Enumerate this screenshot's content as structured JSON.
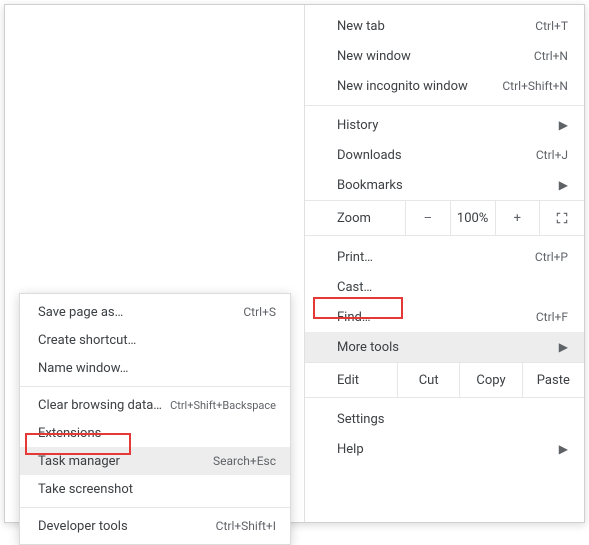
{
  "main_menu": {
    "new_tab": {
      "label": "New tab",
      "shortcut": "Ctrl+T"
    },
    "new_window": {
      "label": "New window",
      "shortcut": "Ctrl+N"
    },
    "new_incognito": {
      "label": "New incognito window",
      "shortcut": "Ctrl+Shift+N"
    },
    "history": {
      "label": "History"
    },
    "downloads": {
      "label": "Downloads",
      "shortcut": "Ctrl+J"
    },
    "bookmarks": {
      "label": "Bookmarks"
    },
    "zoom": {
      "label": "Zoom",
      "minus": "–",
      "value": "100%",
      "plus": "+"
    },
    "print": {
      "label": "Print…",
      "shortcut": "Ctrl+P"
    },
    "cast": {
      "label": "Cast…"
    },
    "find": {
      "label": "Find…",
      "shortcut": "Ctrl+F"
    },
    "more_tools": {
      "label": "More tools"
    },
    "edit": {
      "label": "Edit",
      "cut": "Cut",
      "copy": "Copy",
      "paste": "Paste"
    },
    "settings": {
      "label": "Settings"
    },
    "help": {
      "label": "Help"
    }
  },
  "submenu": {
    "save_page": {
      "label": "Save page as…",
      "shortcut": "Ctrl+S"
    },
    "create_shortcut": {
      "label": "Create shortcut…"
    },
    "name_window": {
      "label": "Name window…"
    },
    "clear_browsing": {
      "label": "Clear browsing data…",
      "shortcut": "Ctrl+Shift+Backspace"
    },
    "extensions": {
      "label": "Extensions"
    },
    "task_manager": {
      "label": "Task manager",
      "shortcut": "Search+Esc"
    },
    "take_screenshot": {
      "label": "Take screenshot"
    },
    "developer_tools": {
      "label": "Developer tools",
      "shortcut": "Ctrl+Shift+I"
    }
  }
}
